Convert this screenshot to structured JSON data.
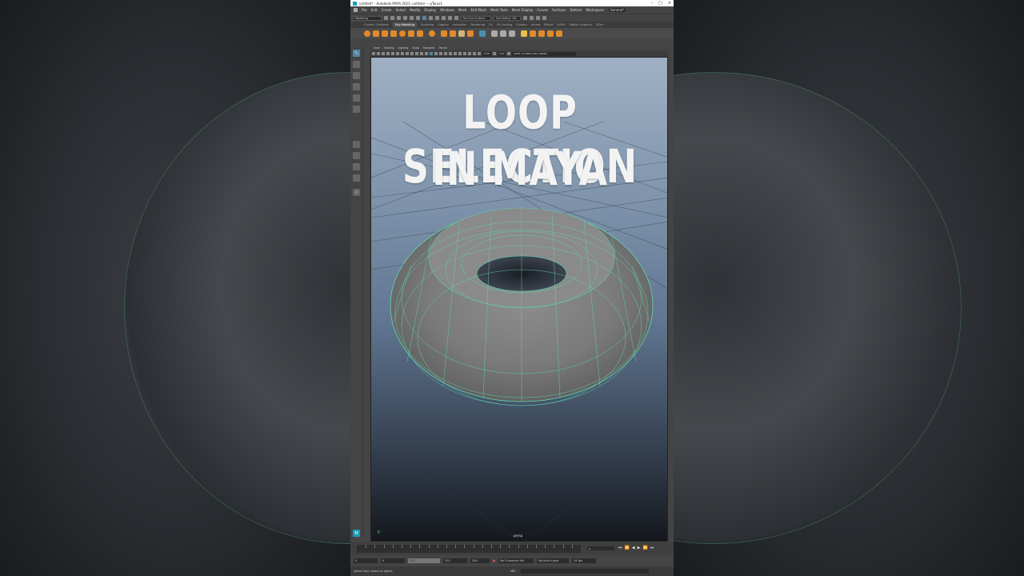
{
  "window": {
    "title": "untitled* - Autodesk MAYA 2023: untitled  ---  pTorus1",
    "buttons": [
      "–",
      "□",
      "×"
    ]
  },
  "menubar": {
    "items": [
      "File",
      "Edit",
      "Create",
      "Select",
      "Modify",
      "Display",
      "Windows",
      "Mesh",
      "Edit Mesh",
      "Mesh Tools",
      "Mesh Display",
      "Curves",
      "Surfaces",
      "Deform",
      "Workspace:",
      "General*"
    ]
  },
  "statusline": {
    "menuset": "Modeling",
    "live_surface": "No Live Surface",
    "symmetry": "Symmetry: Off"
  },
  "shelf": {
    "tabs": [
      "Curves / Surfaces",
      "Poly Modeling",
      "Sculpting",
      "Rigging",
      "Animation",
      "Rendering",
      "FX",
      "FX Caching",
      "Custom",
      "Arnold",
      "Bifrost",
      "MASH",
      "Motion Graphics",
      "XGen"
    ],
    "active_tab": "Poly Modeling"
  },
  "panel": {
    "menus": [
      "View",
      "Shading",
      "Lighting",
      "Show",
      "Renderer",
      "Panels"
    ],
    "field_1": "0.00",
    "field_2": "1.00",
    "colorspace": "ACES 1.0 SDR-video (sRGB)"
  },
  "viewport": {
    "headline_line1": "LOOP SELECTION",
    "headline_line2": "IN MAYA",
    "camera": "persp",
    "axis_label": "y"
  },
  "timeline": {
    "ticks": [
      "5",
      "10",
      "15",
      "20",
      "25",
      "30",
      "35",
      "40",
      "45",
      "50",
      "55",
      "60",
      "65",
      "70",
      "75",
      "80",
      "85",
      "90",
      "95",
      "100",
      "105",
      "110",
      "115",
      "120"
    ],
    "current_frame": "0"
  },
  "rangebar": {
    "start": "0",
    "inner_start": "0",
    "inner_end": "120",
    "end": "200",
    "range_end": "120",
    "character_set": "No Character Set",
    "anim_layer": "No Anim Layer",
    "fps": "24 fps"
  },
  "helpline": {
    "text": "Select Tool: select an object",
    "mel_label": "MEL"
  },
  "colors": {
    "wire": "#5fd9b0",
    "selection_blue": "#5285a6"
  }
}
